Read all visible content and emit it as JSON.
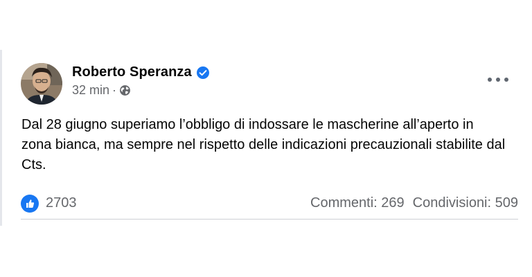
{
  "post": {
    "author_name": "Roberto Speranza",
    "verified_icon": "verified-badge-icon",
    "timestamp": "32 min",
    "separator": "·",
    "audience_icon": "globe-icon",
    "more_icon": "more-options-icon",
    "text": "Dal 28 giugno superiamo l’obbligo di indossare le mascherine all’aperto in zona bianca, ma sempre nel rispetto delle indicazioni precauzionali stabilite dal Cts."
  },
  "footer": {
    "like_icon": "like-icon",
    "likes_count": "2703",
    "comments": "Commenti: 269",
    "shares": "Condivisioni: 509"
  },
  "colors": {
    "accent": "#1877f2",
    "secondary_text": "#65676b",
    "primary_text": "#050505"
  }
}
